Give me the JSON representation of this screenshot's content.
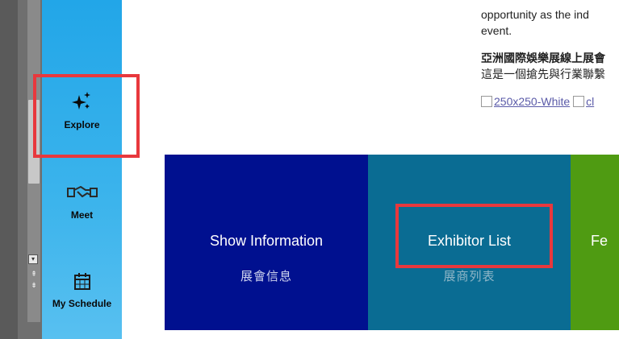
{
  "sidebar": {
    "items": [
      {
        "label": "Explore",
        "icon": "sparkles-icon"
      },
      {
        "label": "Meet",
        "icon": "handshake-icon"
      },
      {
        "label": "My Schedule",
        "icon": "calendar-icon"
      }
    ],
    "color": "#22a6e8"
  },
  "content": {
    "line1": "opportunity as the ind",
    "line2": "event.",
    "zh_title": "亞洲國際娛樂展線上展會",
    "zh_body": "這是一個搶先與行業聯繫",
    "link1": "250x250-White",
    "link2": "cl"
  },
  "tiles": [
    {
      "en": "Show Information",
      "zh": "展會信息",
      "color": "#00108f"
    },
    {
      "en": "Exhibitor List",
      "zh": "展商列表",
      "color": "#0a6c93"
    },
    {
      "en": "Fe",
      "zh": "",
      "color": "#4f9b12"
    }
  ],
  "highlight_color": "#e8383d"
}
